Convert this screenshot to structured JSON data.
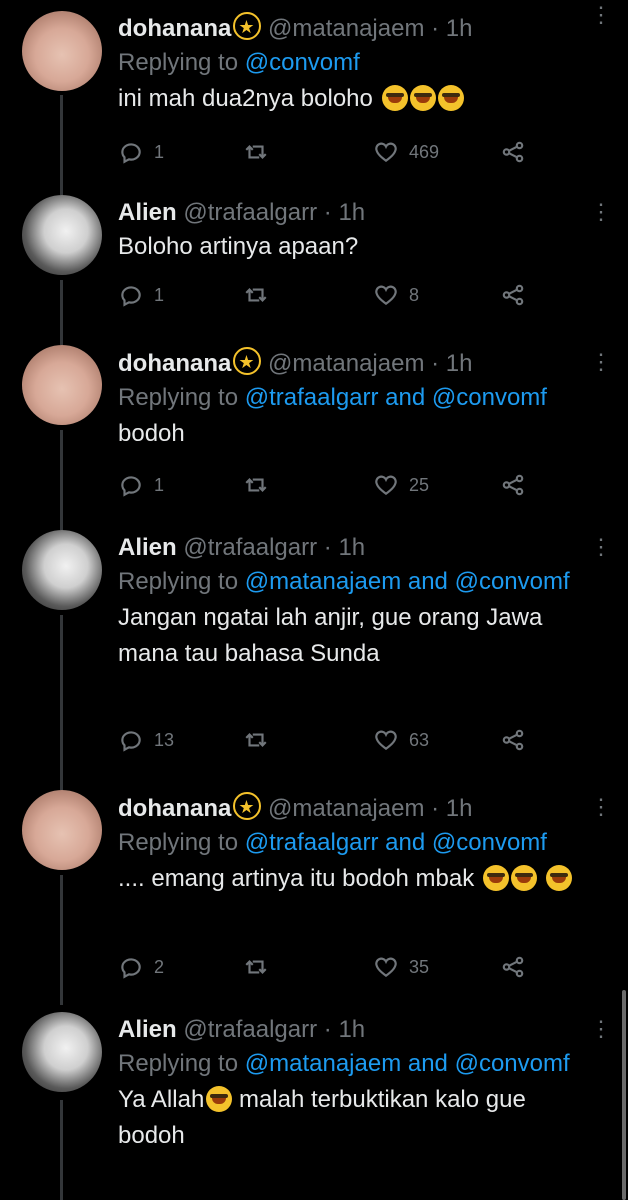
{
  "tweets": [
    {
      "name": "dohanana",
      "handle": "@matanajaem",
      "dot": "·",
      "time": "1h",
      "replying_prefix": "Replying to",
      "mentions": [
        "@convomf"
      ],
      "text": "ini mah dua2nya boloho",
      "emoji_count": 3,
      "replies": "1",
      "retweets": "",
      "likes": "469"
    },
    {
      "name": "Alien",
      "handle": "@trafaalgarr",
      "dot": "·",
      "time": "1h",
      "replying_prefix": "",
      "mentions": [],
      "text": "Boloho artinya apaan?",
      "emoji_count": 0,
      "replies": "1",
      "retweets": "",
      "likes": "8"
    },
    {
      "name": "dohanana",
      "handle": "@matanajaem",
      "dot": "·",
      "time": "1h",
      "replying_prefix": "Replying to",
      "mentions": [
        "@trafaalgarr",
        "and",
        "@convomf"
      ],
      "text": "bodoh",
      "emoji_count": 0,
      "replies": "1",
      "retweets": "",
      "likes": "25"
    },
    {
      "name": "Alien",
      "handle": "@trafaalgarr",
      "dot": "·",
      "time": "1h",
      "replying_prefix": "Replying to",
      "mentions": [
        "@matanajaem",
        "and",
        "@convomf"
      ],
      "text": "Jangan ngatai lah anjir, gue orang Jawa mana tau bahasa Sunda",
      "emoji_count": 0,
      "replies": "13",
      "retweets": "",
      "likes": "63"
    },
    {
      "name": "dohanana",
      "handle": "@matanajaem",
      "dot": "·",
      "time": "1h",
      "replying_prefix": "Replying to",
      "mentions": [
        "@trafaalgarr",
        "and",
        "@convomf"
      ],
      "text": ".... emang artinya itu bodoh mbak",
      "emoji_count": 3,
      "replies": "2",
      "retweets": "",
      "likes": "35"
    },
    {
      "name": "Alien",
      "handle": "@trafaalgarr",
      "dot": "·",
      "time": "1h",
      "replying_prefix": "Replying to",
      "mentions": [
        "@matanajaem",
        "and",
        "@convomf"
      ],
      "text_part1": "Ya Allah",
      "text_part2": "malah terbuktikan kalo gue bodoh",
      "emoji_count": 1,
      "replies": "",
      "retweets": "",
      "likes": ""
    }
  ],
  "icons": {
    "reply": "reply-icon",
    "retweet": "retweet-icon",
    "like": "heart-icon",
    "share": "share-icon",
    "more": "more-icon",
    "crying_emoji": "loudly-crying-face-emoji",
    "badge": "dizzy-emoji"
  },
  "colors": {
    "background": "#000000",
    "text": "#e7e9ea",
    "muted": "#71767b",
    "mention": "#1d9bf0"
  }
}
